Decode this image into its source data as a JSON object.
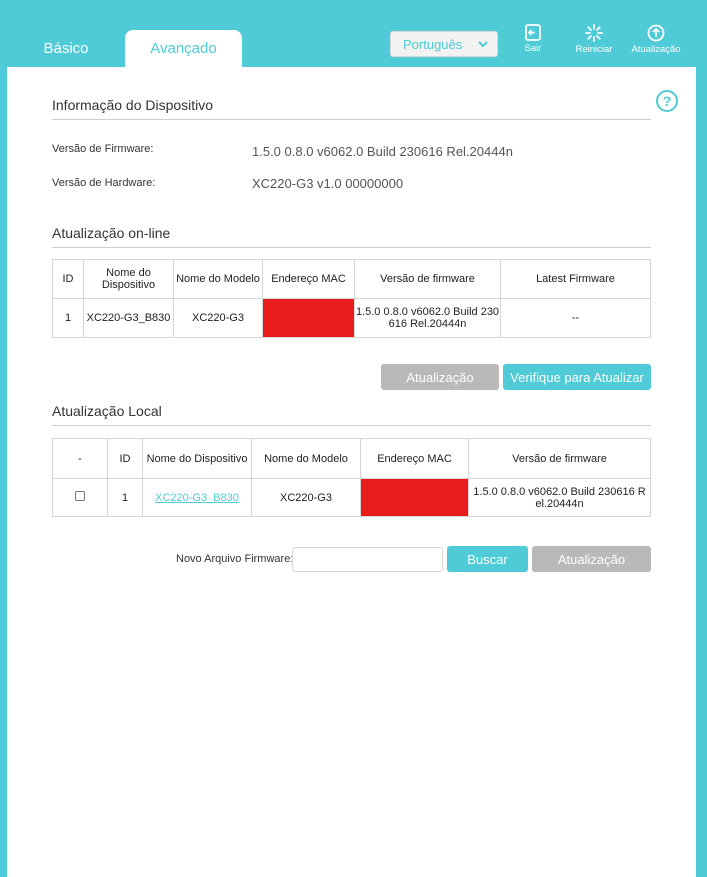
{
  "tabs": {
    "basic": "Básico",
    "advanced": "Avançado"
  },
  "language": {
    "selected": "Português"
  },
  "top_buttons": {
    "logout": "Sair",
    "reboot": "Reiniciar",
    "update": "Atualização"
  },
  "device_info": {
    "title": "Informação do Dispositivo",
    "firmware_label": "Versão de Firmware:",
    "firmware_value": "1.5.0 0.8.0 v6062.0 Build 230616 Rel.20444n",
    "hardware_label": "Versão de Hardware:",
    "hardware_value": "XC220-G3 v1.0 00000000"
  },
  "online": {
    "title": "Atualização on-line",
    "headers": [
      "ID",
      "Nome do Dispositivo",
      "Nome do Modelo",
      "Endereço MAC",
      "Versão de firmware",
      "Latest Firmware"
    ],
    "row": {
      "id": "1",
      "device": "XC220-G3_B830",
      "model": "XC220-G3",
      "mac": "",
      "firmware": "1.5.0 0.8.0 v6062.0 Build 230 616 Rel.20444n",
      "latest": "--"
    },
    "update_button": "Atualização",
    "check_button": "Verifique para Atualizar"
  },
  "local": {
    "title": "Atualização Local",
    "headers": [
      "-",
      "ID",
      "Nome do Dispositivo",
      "Nome do Modelo",
      "Endereço MAC",
      "Versão de firmware"
    ],
    "row": {
      "id": "1",
      "device": "XC220-G3_B830",
      "model": "XC220-G3",
      "mac": "",
      "firmware": "1.5.0 0.8.0 v6062.0 Build 230616 R el.20444n"
    },
    "file_label": "Novo Arquivo Firmware:",
    "browse_button": "Buscar",
    "update_button": "Atualização"
  },
  "colors": {
    "accent": "#4ecbd6",
    "disabled": "#b9b9b9",
    "redaction": "#e81c1c"
  }
}
